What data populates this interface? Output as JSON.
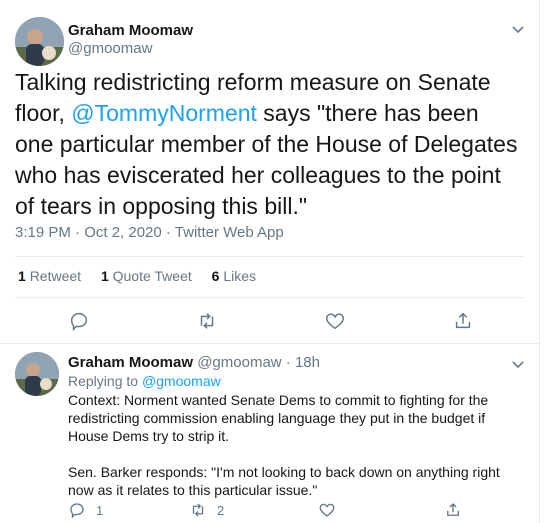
{
  "main_tweet": {
    "author_name": "Graham Moomaw",
    "author_handle": "@gmoomaw",
    "text_before": "Talking redistricting reform measure on Senate floor, ",
    "mention": "@TommyNorment",
    "text_after": " says \"there has been one particular member of the House of Delegates who has eviscerated her colleagues to the point of tears in opposing this bill.\"",
    "timestamp": "3:19 PM · Oct 2, 2020 · Twitter Web App",
    "stats": {
      "retweets_count": "1",
      "retweets_label": "Retweet",
      "quotes_count": "1",
      "quotes_label": "Quote Tweet",
      "likes_count": "6",
      "likes_label": "Likes"
    },
    "actions": [
      "reply-icon",
      "retweet-icon",
      "like-icon",
      "share-icon"
    ]
  },
  "reply_tweet": {
    "author_name": "Graham Moomaw",
    "author_handle_time": "@gmoomaw · 18h",
    "replying_prefix": "Replying to ",
    "replying_to": "@gmoomaw",
    "paragraph1": "Context: Norment wanted Senate Dems to commit to fighting for the redistricting commission enabling language they put in the budget if House Dems try to strip it.",
    "paragraph2": "Sen. Barker responds: \"I'm not looking to back down on anything right now as it relates to this particular issue.\"",
    "reply_count": "1",
    "retweet_count": "2"
  },
  "colors": {
    "accent": "#1da1f2",
    "muted": "#657786",
    "text": "#14171a",
    "border": "#e6ecf0"
  }
}
